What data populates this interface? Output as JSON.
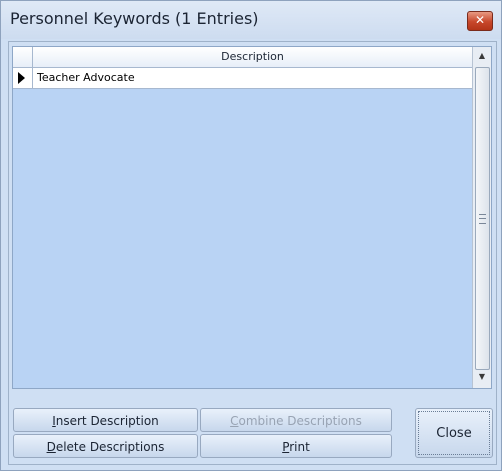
{
  "window": {
    "title": "Personnel Keywords (1 Entries)",
    "close_glyph": "✕"
  },
  "grid": {
    "column_header": "Description",
    "rows": [
      {
        "description": "Teacher Advocate",
        "current": true
      }
    ]
  },
  "scrollbar": {
    "up_glyph": "▲",
    "down_glyph": "▼"
  },
  "buttons": {
    "insert": {
      "mnemonic": "I",
      "rest": "nsert Description"
    },
    "combine": {
      "mnemonic": "C",
      "rest": "ombine Descriptions"
    },
    "delete": {
      "mnemonic": "D",
      "rest": "elete Descriptions"
    },
    "print": {
      "mnemonic": "P",
      "rest": "rint"
    },
    "close": "Close"
  }
}
